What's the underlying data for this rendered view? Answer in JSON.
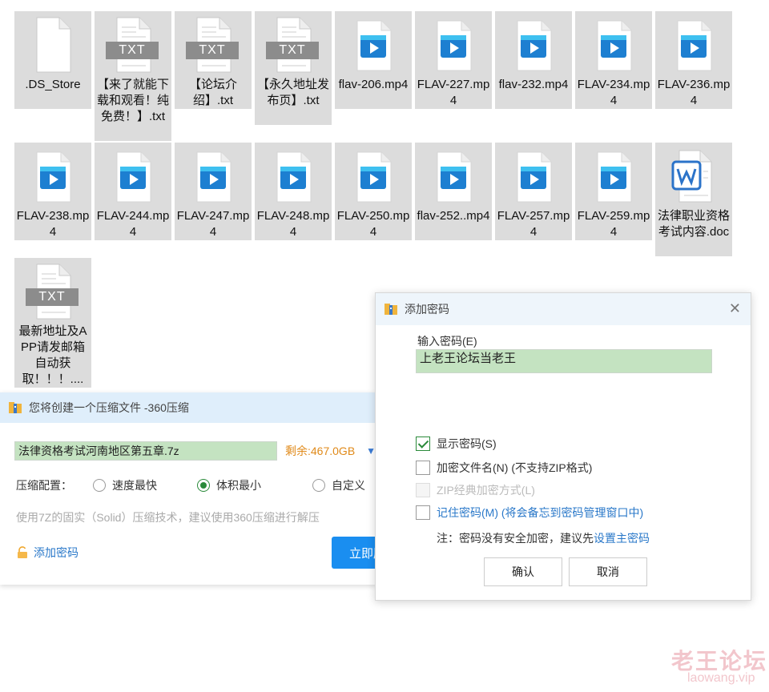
{
  "files": [
    {
      "name": ".DS_Store",
      "type": "blank"
    },
    {
      "name": "【来了就能下载和观看！纯免费！】.txt",
      "type": "txt"
    },
    {
      "name": "【论坛介绍】.txt",
      "type": "txt"
    },
    {
      "name": "【永久地址发布页】.txt",
      "type": "txt"
    },
    {
      "name": "flav-206.mp4",
      "type": "video"
    },
    {
      "name": "FLAV-227.mp4",
      "type": "video"
    },
    {
      "name": "flav-232.mp4",
      "type": "video"
    },
    {
      "name": "FLAV-234.mp4",
      "type": "video"
    },
    {
      "name": "FLAV-236.mp4",
      "type": "video"
    },
    {
      "name": "FLAV-238.mp4",
      "type": "video"
    },
    {
      "name": "FLAV-244.mp4",
      "type": "video"
    },
    {
      "name": "FLAV-247.mp4",
      "type": "video"
    },
    {
      "name": "FLAV-248.mp4",
      "type": "video"
    },
    {
      "name": "FLAV-250.mp4",
      "type": "video"
    },
    {
      "name": "flav-252..mp4",
      "type": "video"
    },
    {
      "name": "FLAV-257.mp4",
      "type": "video"
    },
    {
      "name": "FLAV-259.mp4",
      "type": "video"
    },
    {
      "name": "法律职业资格考试内容.doc",
      "type": "doc"
    },
    {
      "name": "最新地址及APP请发邮箱自动获取！！！....",
      "type": "txt"
    }
  ],
  "txt_icon_label": "TXT",
  "compress_dialog": {
    "title": "您将创建一个压缩文件 -360压缩",
    "archive_name": "法律资格考试河南地区第五章.7z",
    "free_space": "剩余:467.0GB",
    "config_label": "压缩配置：",
    "options": [
      "速度最快",
      "体积最小",
      "自定义"
    ],
    "selected_option": "体积最小",
    "hint": "使用7Z的固实（Solid）压缩技术，建议使用360压缩进行解压",
    "add_password": "添加密码",
    "start_button": "立即压缩"
  },
  "password_dialog": {
    "title": "添加密码",
    "input_label": "输入密码(E)",
    "password_value": "上老王论坛当老王",
    "show_password": "显示密码(S)",
    "encrypt_filenames": "加密文件名(N) (不支持ZIP格式)",
    "zip_classic": "ZIP经典加密方式(L)",
    "remember_password": "记住密码(M) (将会备忘到密码管理窗口中)",
    "note_prefix": "注：密码没有安全加密，建议先",
    "note_link": "设置主密码",
    "ok": "确认",
    "cancel": "取消"
  },
  "watermark": {
    "cn": "老王论坛",
    "en": "laowang.vip"
  }
}
